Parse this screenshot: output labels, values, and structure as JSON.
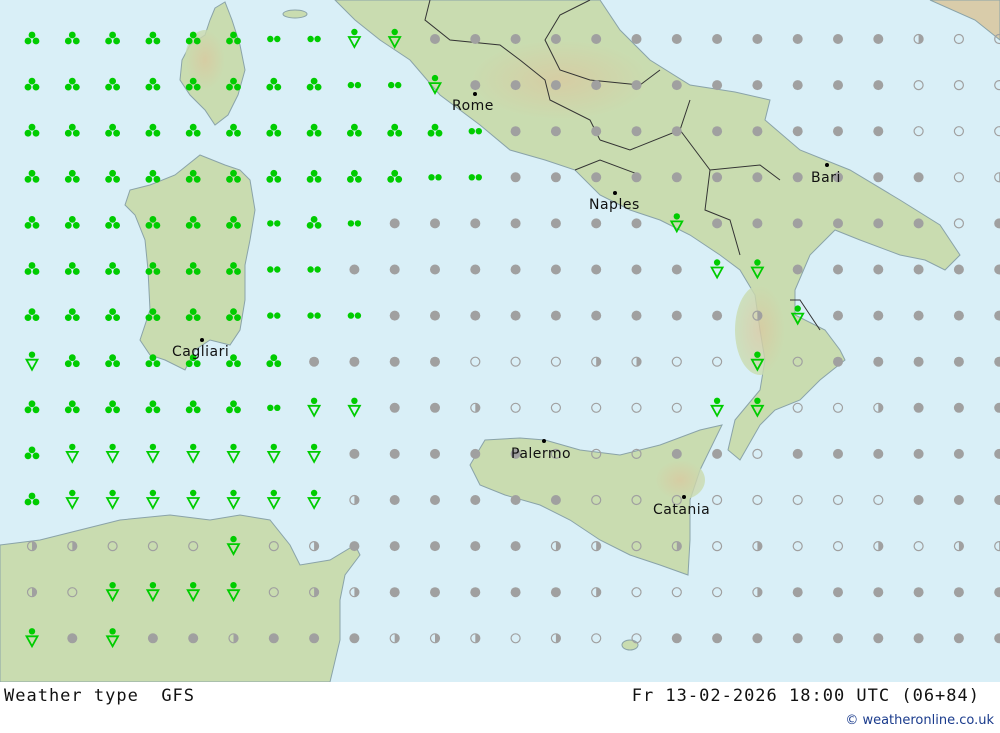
{
  "header": {
    "product_label": "Weather type",
    "model": "GFS",
    "valid_time": "Fr 13-02-2026 18:00 UTC (06+84)"
  },
  "credit": "© weatheronline.co.uk",
  "colors": {
    "sea": "#d9eff7",
    "land": "#c9dcb0",
    "snow_symbol": "#00cc00",
    "cloud_symbol": "#a0a0a0",
    "border": "#333333"
  },
  "cities": [
    {
      "name": "Rome"
    },
    {
      "name": "Naples"
    },
    {
      "name": "Bari"
    },
    {
      "name": "Cagliari"
    },
    {
      "name": "Palermo"
    },
    {
      "name": "Catania"
    }
  ],
  "legend_codes": {
    "C": "snow-cluster-symbol",
    "D": "snow-double-dot-symbol",
    "S": "snow-shower-symbol",
    "G": "overcast-symbol",
    "H": "half-cloud-symbol",
    "O": "clear-symbol"
  },
  "grid_rows": [
    "CCCCCCDDSSGGGGGGGGGGGGHOOS",
    "CCCCCCCCDDSGGGGGGGGGGGOOOH",
    "CCCCCCCCCCCDGGGGGGGGGGOOOO",
    "CCCCCCCCCCDDGGGGGGGGGGGOHO",
    "CCCCCCDCDGGGGGGGSGGGGGGOGO",
    "CCCCCCDDGGGGGGGGGSSGGGGGGO",
    "CCCCCCDDDGGGGGGGGGHSGGGGGO",
    "SCCCCCCGGGGOOOHHOOSOGGGGGO",
    "CCCCCCDSSGGHOOOOOSSOOHGGGG",
    "CSSSSSSSGGGGGOOOGGOGGGGGGG",
    "CSSSSSSSHGGGGGOOOOOOOOGGGG",
    "HHOOOSOHGGGGGHHOHOHOOHOHHH",
    "HOSSSSOHHGGGGGHOOOHGGGGGGO",
    "SGSGGHGGGHHHOHOOGGGGGGGGGG"
  ]
}
